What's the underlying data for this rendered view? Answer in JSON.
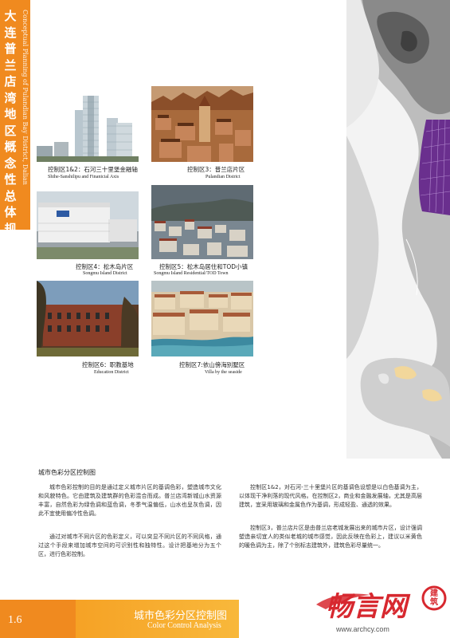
{
  "side": {
    "title_chars": [
      "大",
      "连",
      "普",
      "兰",
      "店",
      "湾",
      "地",
      "区",
      "概",
      "念",
      "性",
      "总",
      "体",
      "规",
      "划"
    ],
    "subtitle": "Conceptual Planning of Pulandian Bay District, Dalian"
  },
  "photos": [
    {
      "cn": "控制区1&2：石河三十里堡金融轴",
      "en": "Shihe-Sanshilipu and Finanicial Axis"
    },
    {
      "cn": "控制区3：普兰店片区",
      "en": "Pulandian District"
    },
    {
      "cn": "控制区4：松木岛片区",
      "en": "Songmu Island District"
    },
    {
      "cn": "控制区5：松木岛居住和TOD小镇",
      "en": "Songmu Island Residential/TOD  Town"
    },
    {
      "cn": "控制区6：职教基地",
      "en": "Education District"
    },
    {
      "cn": "控制区7:依山傍海别墅区",
      "en": "Villa by the seaside"
    }
  ],
  "body": {
    "heading": "城市色彩分区控制图",
    "left_paragraphs": [
      "城市色彩控制的目的是通过定义城市片区的基调色彩，塑造城市文化和风貌特色。它由建筑及建筑群的色彩混合而成。普兰店湾新城山水资源丰富，自然色彩为绿色调和蓝色调，冬季气温偏低，山水也呈灰色调，因此不宜使用偏冷性色调。",
      "通过对城市不同片区的色彩定义，可以突显不同片区的不同风格，通过这个手段来增加城市空间的可识别性和独特性。设计把基地分为五个区，进行色彩控制。"
    ],
    "right_paragraphs": [
      "控制区1&2，对石河-三十里堡片区的基调色设想是以白色基调为主，以体现干净利落的现代风格。在控制区2，商业和金融发展轴，尤其是高层建筑，宜采用玻璃和金属色作为基调，形成轻盈、通透的效果。",
      "控制区3，普兰店片区是由普兰店老城发展出来的城市片区，设计强调塑造亲切宜人的类似老城的城市感觉，因此反映在色彩上，建议以米黄色的暖色调为主，除了个别标志建筑外，建筑色彩尽量统一。"
    ]
  },
  "footer": {
    "page_number": "1.6",
    "title_cn": "城市色彩分区控制图",
    "title_en": "Color Control Analysis",
    "logo_text": "畅言网",
    "logo_seal": "建筑",
    "site": "www.archcy.com"
  },
  "colors": {
    "accent": "#f08a1f",
    "footer_gradient": "#f8b83b",
    "map_purple": "#6a2f8e",
    "logo_red": "#d7282f"
  }
}
